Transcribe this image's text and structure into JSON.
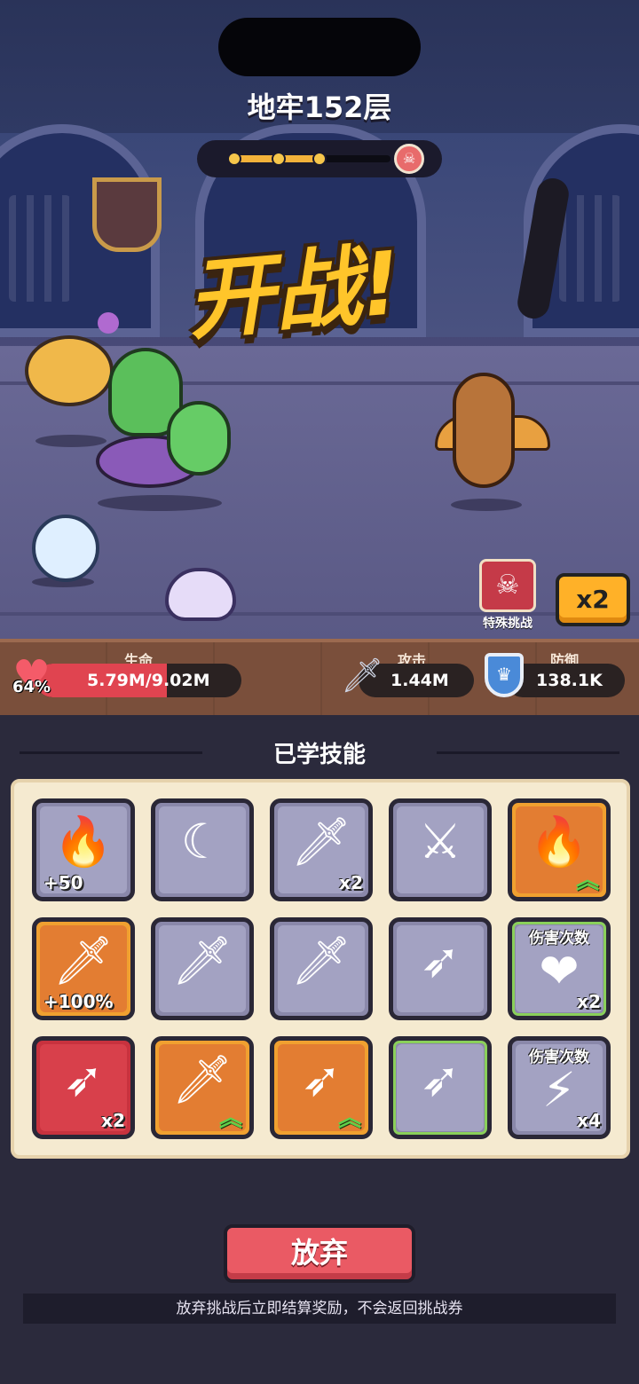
{
  "level": {
    "title": "地牢152层",
    "progress": 0.55,
    "boss_icon": "skull-icon"
  },
  "battle": {
    "banner": "开战!"
  },
  "special_challenge": {
    "label": "特殊挑战",
    "icon": "skull-icon"
  },
  "speed": {
    "label": "x2"
  },
  "stats": {
    "hp": {
      "label": "生命",
      "value": "5.79M/9.02M",
      "percent": "64%",
      "fraction": 0.64
    },
    "attack": {
      "label": "攻击",
      "value": "1.44M"
    },
    "defense": {
      "label": "防御",
      "value": "138.1K"
    }
  },
  "skills": {
    "title": "已学技能",
    "items": [
      {
        "icon": "flame-icon",
        "badge": "+50",
        "style": "gray",
        "glyph": "🔥"
      },
      {
        "icon": "crescent-slash-icon",
        "badge": "",
        "style": "gray",
        "glyph": "☾"
      },
      {
        "icon": "sword-icon",
        "badge": "x2",
        "style": "gray",
        "glyph": "🗡"
      },
      {
        "icon": "sword-split-icon",
        "badge": "",
        "style": "gray",
        "glyph": "⚔"
      },
      {
        "icon": "flame-upgrade-icon",
        "badge": "",
        "style": "orange",
        "glyph": "🔥"
      },
      {
        "icon": "fire-sword-icon",
        "badge": "+100%",
        "style": "orange",
        "glyph": "🗡"
      },
      {
        "icon": "poison-sword-icon",
        "badge": "",
        "style": "gray",
        "glyph": "🗡"
      },
      {
        "icon": "lightning-fire-sword-icon",
        "badge": "",
        "style": "gray",
        "glyph": "🗡"
      },
      {
        "icon": "kunai-icon",
        "badge": "",
        "style": "gray",
        "glyph": "➶"
      },
      {
        "icon": "heart-plus-icon",
        "top_label": "伤害次数",
        "badge": "x2",
        "style": "green",
        "glyph": "❤"
      },
      {
        "icon": "kunai-icon",
        "badge": "x2",
        "style": "redc",
        "glyph": "➶"
      },
      {
        "icon": "explosive-sword-icon",
        "badge": "",
        "style": "orange",
        "glyph": "🗡"
      },
      {
        "icon": "kunai-upgrade-icon",
        "badge": "",
        "style": "orange",
        "glyph": "➶"
      },
      {
        "icon": "fire-kunai-icon",
        "badge": "",
        "style": "green",
        "glyph": "➶"
      },
      {
        "icon": "lightning-icon",
        "top_label": "伤害次数",
        "badge": "x4",
        "style": "gray",
        "glyph": "⚡"
      }
    ]
  },
  "actions": {
    "abandon_label": "放弃",
    "notice": "放弃挑战后立即结算奖励，不会返回挑战券"
  },
  "colors": {
    "accent": "#ffc52a",
    "hp": "#e04450",
    "abandon": "#ea5a64",
    "panel": "#f5ead0"
  }
}
